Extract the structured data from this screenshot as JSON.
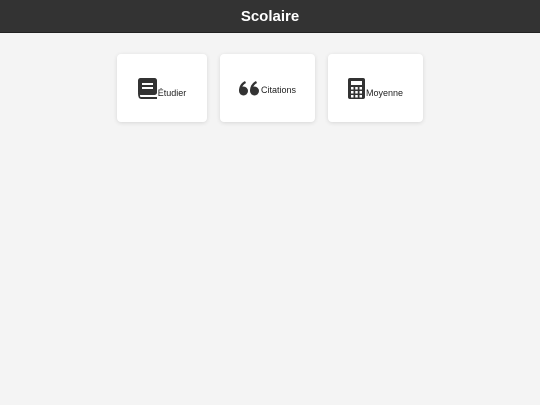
{
  "header": {
    "title": "Scolaire"
  },
  "cards": [
    {
      "label": "Étudier",
      "icon": "book-icon"
    },
    {
      "label": "Citations",
      "icon": "quote-icon"
    },
    {
      "label": "Moyenne",
      "icon": "calculator-icon"
    }
  ],
  "colors": {
    "header_bg": "#333333",
    "page_bg": "#f4f4f4",
    "card_bg": "#ffffff",
    "icon": "#333333"
  }
}
